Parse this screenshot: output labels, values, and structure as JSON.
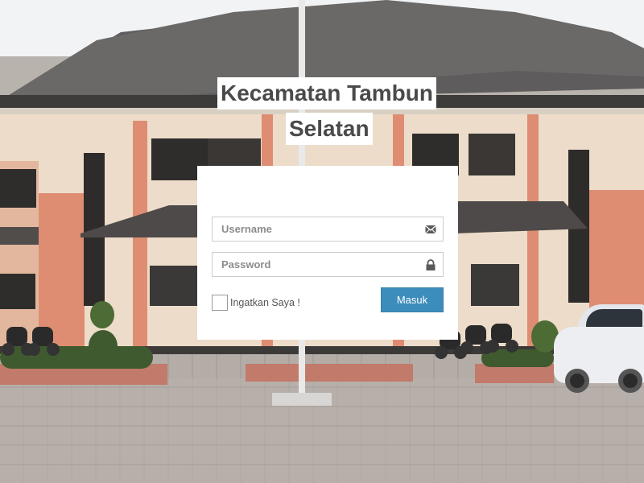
{
  "page": {
    "title_line_1": "Kecamatan Tambun",
    "title_line_2": "Selatan"
  },
  "login_form": {
    "username_placeholder": "Username",
    "password_placeholder": "Password",
    "username_icon": "envelope-icon",
    "password_icon": "lock-icon",
    "remember_label": "Ingatkan Saya !",
    "remember_checked": false,
    "submit_label": "Masuk"
  },
  "colors": {
    "button": "#3c8dbc",
    "card": "#ffffff",
    "title_text": "#4a4a4a"
  }
}
